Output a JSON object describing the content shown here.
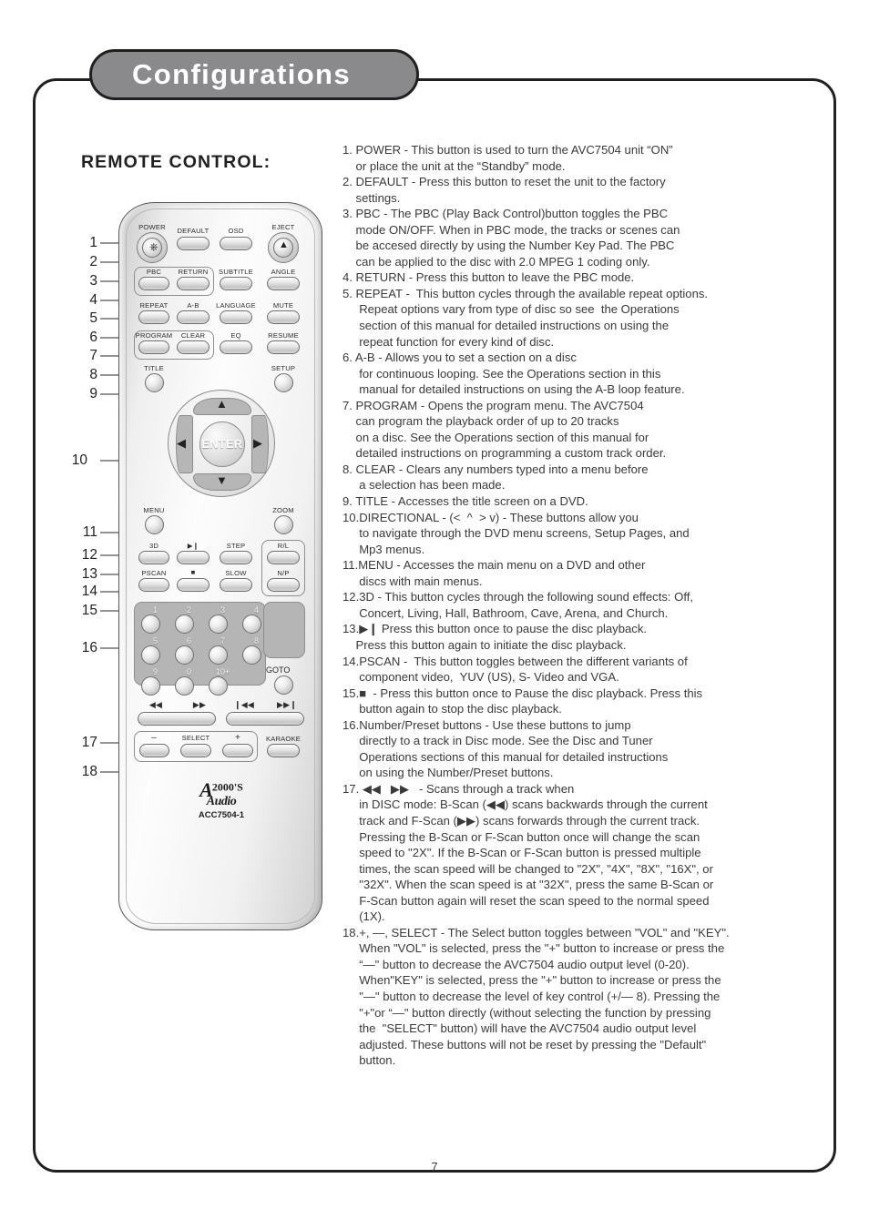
{
  "page": {
    "title": "Configurations",
    "number": "7",
    "section_heading": "REMOTE CONTROL:",
    "accent_gray": "#8a8a8d",
    "outline": "#231f20"
  },
  "instructions": [
    "1. POWER - This button is used to turn the AVC7504 unit “ON”",
    "    or place the unit at the “Standby” mode.",
    "2. DEFAULT - Press this button to reset the unit to the factory",
    "    settings.",
    "3. PBC - The PBC (Play Back Control)button toggles the PBC",
    "    mode ON/OFF. When in PBC mode, the tracks or scenes can",
    "    be accesed directly by using the Number Key Pad. The PBC",
    "    can be applied to the disc with 2.0 MPEG 1 coding only.",
    "4. RETURN - Press this button to leave the PBC mode.",
    "5. REPEAT -  This button cycles through the available repeat options.",
    "     Repeat options vary from type of disc so see  the Operations",
    "     section of this manual for detailed instructions on using the",
    "     repeat function for every kind of disc.",
    "6. A-B - Allows you to set a section on a disc",
    "     for continuous looping. See the Operations section in this",
    "     manual for detailed instructions on using the A-B loop feature.",
    "7. PROGRAM - Opens the program menu. The AVC7504",
    "    can program the playback order of up to 20 tracks",
    "    on a disc. See the Operations section of this manual for",
    "    detailed instructions on programming a custom track order.",
    "8. CLEAR - Clears any numbers typed into a menu before",
    "     a selection has been made.",
    "9. TITLE - Accesses the title screen on a DVD.",
    "10.DIRECTIONAL - (<  ^  > v) - These buttons allow you",
    "     to navigate through the DVD menu screens, Setup Pages, and",
    "     Mp3 menus.",
    "11.MENU - Accesses the main menu on a DVD and other",
    "     discs with main menus.",
    "12.3D - This button cycles through the following sound effects: Off,",
    "     Concert, Living, Hall, Bathroom, Cave, Arena, and Church.",
    "13.▶❙ Press this button once to pause the disc playback.",
    "    Press this button again to initiate the disc playback.",
    "14.PSCAN -  This button toggles between the different variants of",
    "     component video,  YUV (US), S- Video and VGA.",
    "15.■  - Press this button once to Pause the disc playback. Press this",
    "     button again to stop the disc playback.",
    "16.Number/Preset buttons - Use these buttons to jump",
    "     directly to a track in Disc mode. See the Disc and Tuner",
    "     Operations sections of this manual for detailed instructions",
    "     on using the Number/Preset buttons.",
    "17. ◀◀   ▶▶   - Scans through a track when",
    "     in DISC mode: B-Scan (◀◀) scans backwards through the current",
    "     track and F-Scan (▶▶) scans forwards through the current track.",
    "     Pressing the B-Scan or F-Scan button once will change the scan",
    "     speed to \"2X\". If the B-Scan or F-Scan button is pressed multiple",
    "     times, the scan speed will be changed to \"2X\", \"4X\", \"8X\", \"16X\", or",
    "     \"32X\". When the scan speed is at \"32X\", press the same B-Scan or",
    "     F-Scan button again will reset the scan speed to the normal speed",
    "     (1X).",
    "18.+, —, SELECT - The Select button toggles between \"VOL\" and \"KEY\".",
    "     When \"VOL\" is selected, press the \"+\" button to increase or press the",
    "     “—\" button to decrease the AVC7504 audio output level (0-20).",
    "     When\"KEY\" is selected, press the \"+\" button to increase or press the",
    "     \"—\" button to decrease the level of key control (+/— 8). Pressing the",
    "     \"+\"or “—\" button directly (without selecting the function by pressing",
    "     the  \"SELECT\" button) will have the AVC7504 audio output level",
    "     adjusted. These buttons will not be reset by pressing the \"Default\"",
    "     button."
  ],
  "callout_numbers": [
    "1",
    "2",
    "3",
    "4",
    "5",
    "6",
    "7",
    "8",
    "9",
    "10",
    "11",
    "12",
    "13",
    "14",
    "15",
    "16",
    "17",
    "18"
  ],
  "remote": {
    "model": "ACC7504-1",
    "brand_a": "A",
    "brand_2000": "2000'S",
    "brand_audio": "Audio",
    "enter_label": "ENTER",
    "row1": [
      "POWER",
      "DEFAULT",
      "OSD",
      "EJECT"
    ],
    "row2": [
      "PBC",
      "RETURN",
      "SUBTITLE",
      "ANGLE"
    ],
    "row3": [
      "REPEAT",
      "A-B",
      "LANGUAGE",
      "MUTE"
    ],
    "row4": [
      "PROGRAM",
      "CLEAR",
      "EQ",
      "RESUME"
    ],
    "row5": [
      "TITLE",
      "SETUP"
    ],
    "row6": [
      "MENU",
      "ZOOM"
    ],
    "row7": [
      "3D",
      "▶❙",
      "STEP",
      "R/L"
    ],
    "row8": [
      "PSCAN",
      "■",
      "SLOW",
      "N/P"
    ],
    "keypad": [
      "1",
      "2",
      "3",
      "4",
      "5",
      "6",
      "7",
      "8",
      "9",
      "0",
      "10+"
    ],
    "goto_label": "GOTO",
    "scan_labels": [
      "◀◀",
      "▶▶",
      "❙◀◀",
      "▶▶❙"
    ],
    "volume_row": [
      "–",
      "SELECT",
      "+",
      "KARAOKE"
    ]
  }
}
